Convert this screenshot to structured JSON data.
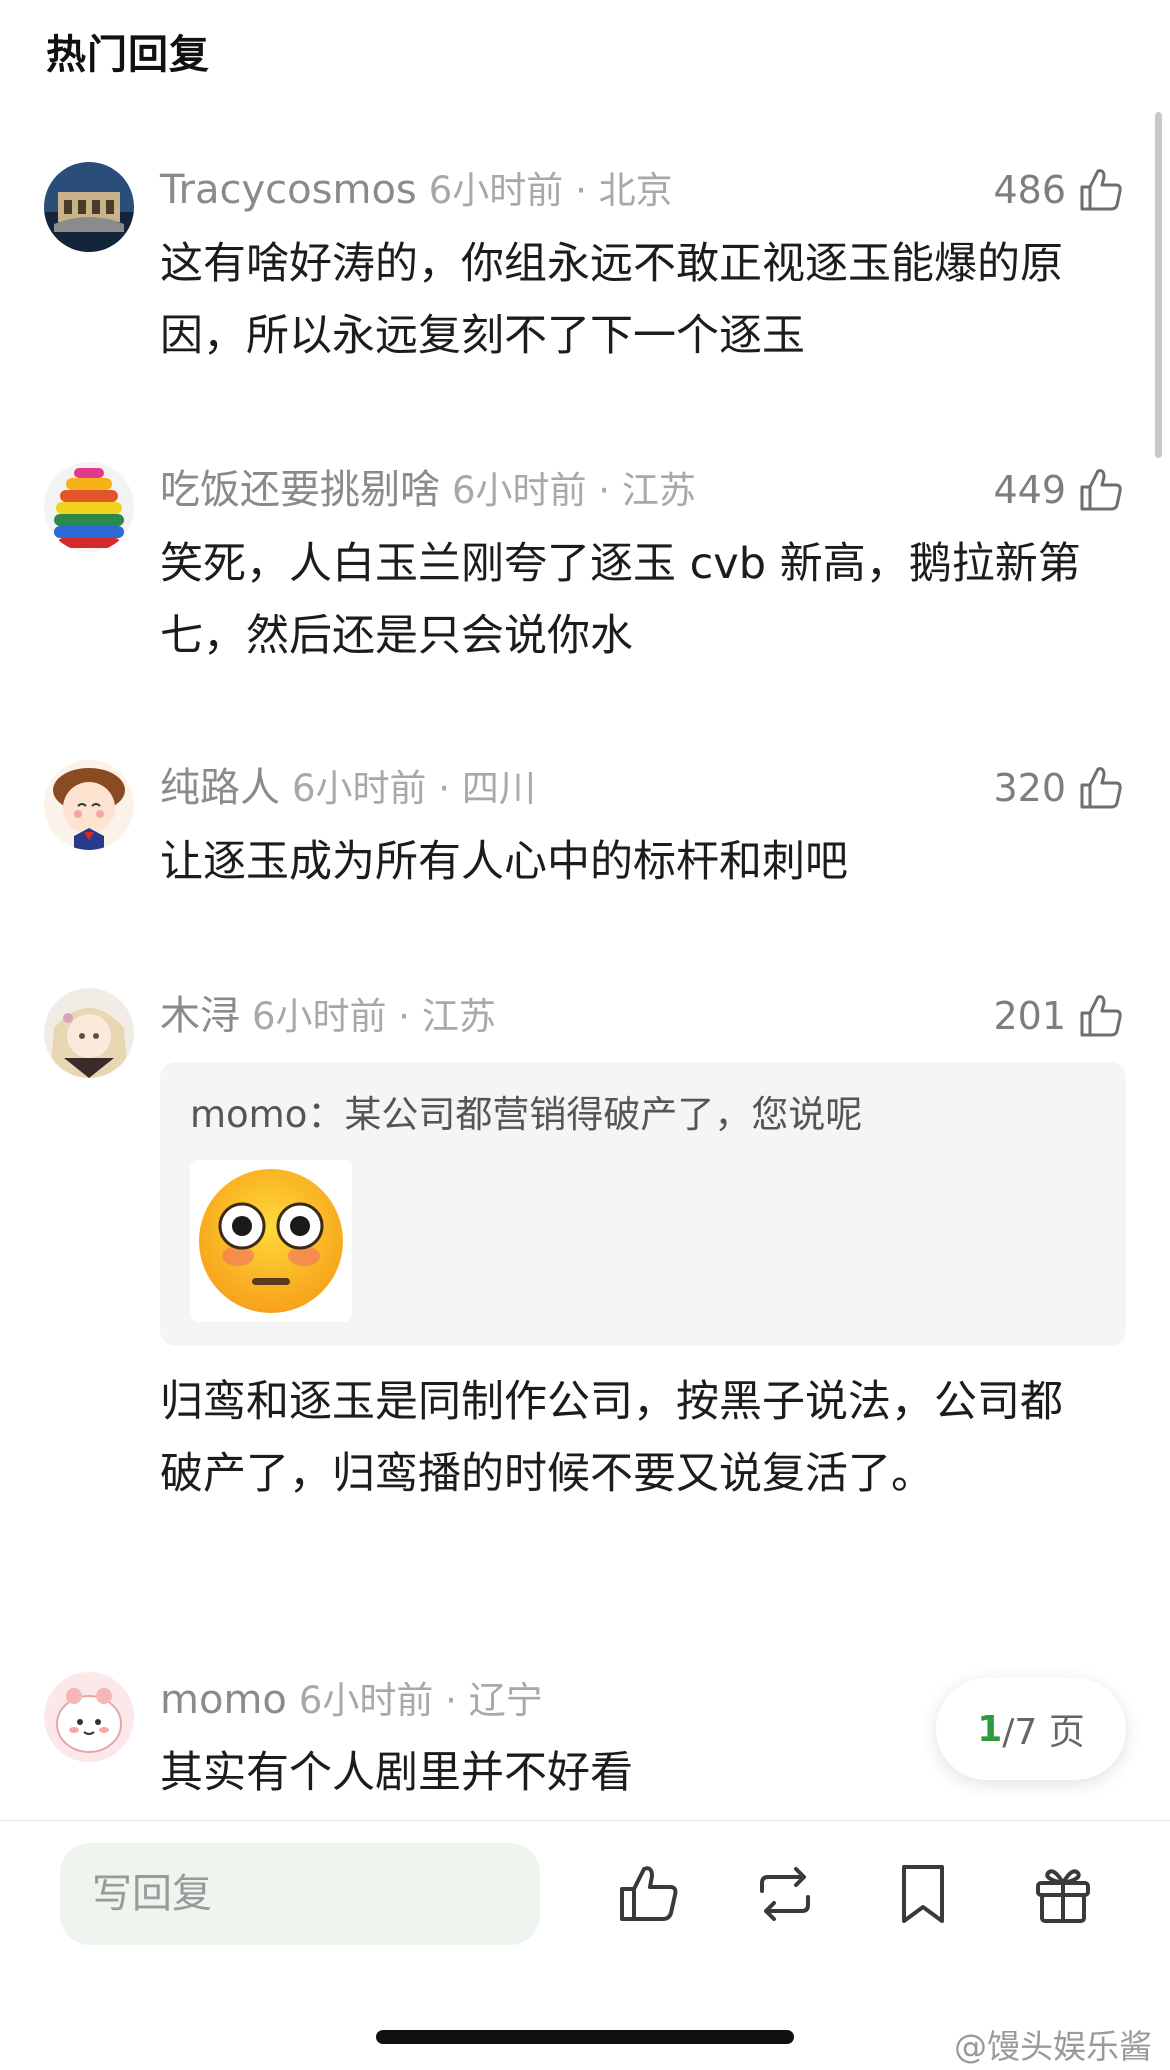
{
  "header": {
    "title": "热门回复"
  },
  "comments": [
    {
      "name": "Tracycosmos",
      "time": "6小时前 · 北京",
      "likes": "486",
      "text": "这有啥好涛的，你组永远不敢正视逐玉能爆的原因，所以永远复刻不了下一个逐玉"
    },
    {
      "name": "吃饭还要挑剔啥",
      "time": "6小时前 · 江苏",
      "likes": "449",
      "text": "笑死，人白玉兰刚夸了逐玉 cvb 新高，鹅拉新第七，然后还是只会说你水"
    },
    {
      "name": "纯路人",
      "time": "6小时前 · 四川",
      "likes": "320",
      "text": "让逐玉成为所有人心中的标杆和刺吧"
    },
    {
      "name": "木浔",
      "time": "6小时前 · 江苏",
      "likes": "201",
      "quote": "momo：某公司都营销得破产了，您说呢",
      "quote_emoji": "flushed-face-emoji",
      "text": "归鸾和逐玉是同制作公司，按黑子说法，公司都破产了，归鸾播的时候不要又说复活了。"
    },
    {
      "name": "momo",
      "time": "6小时前 · 辽宁",
      "text": "其实有个人剧里并不好看"
    }
  ],
  "pager": {
    "current": "1",
    "rest": "/7 页"
  },
  "bottom_bar": {
    "reply_placeholder": "写回复",
    "icons": [
      "thumbs-up-icon",
      "repost-icon",
      "bookmark-icon",
      "gift-icon"
    ]
  },
  "watermark": "@馒头娱乐酱",
  "colors": {
    "accent": "#2e9a3e",
    "meta": "#8a8a8a",
    "text": "#1c1c1c"
  }
}
